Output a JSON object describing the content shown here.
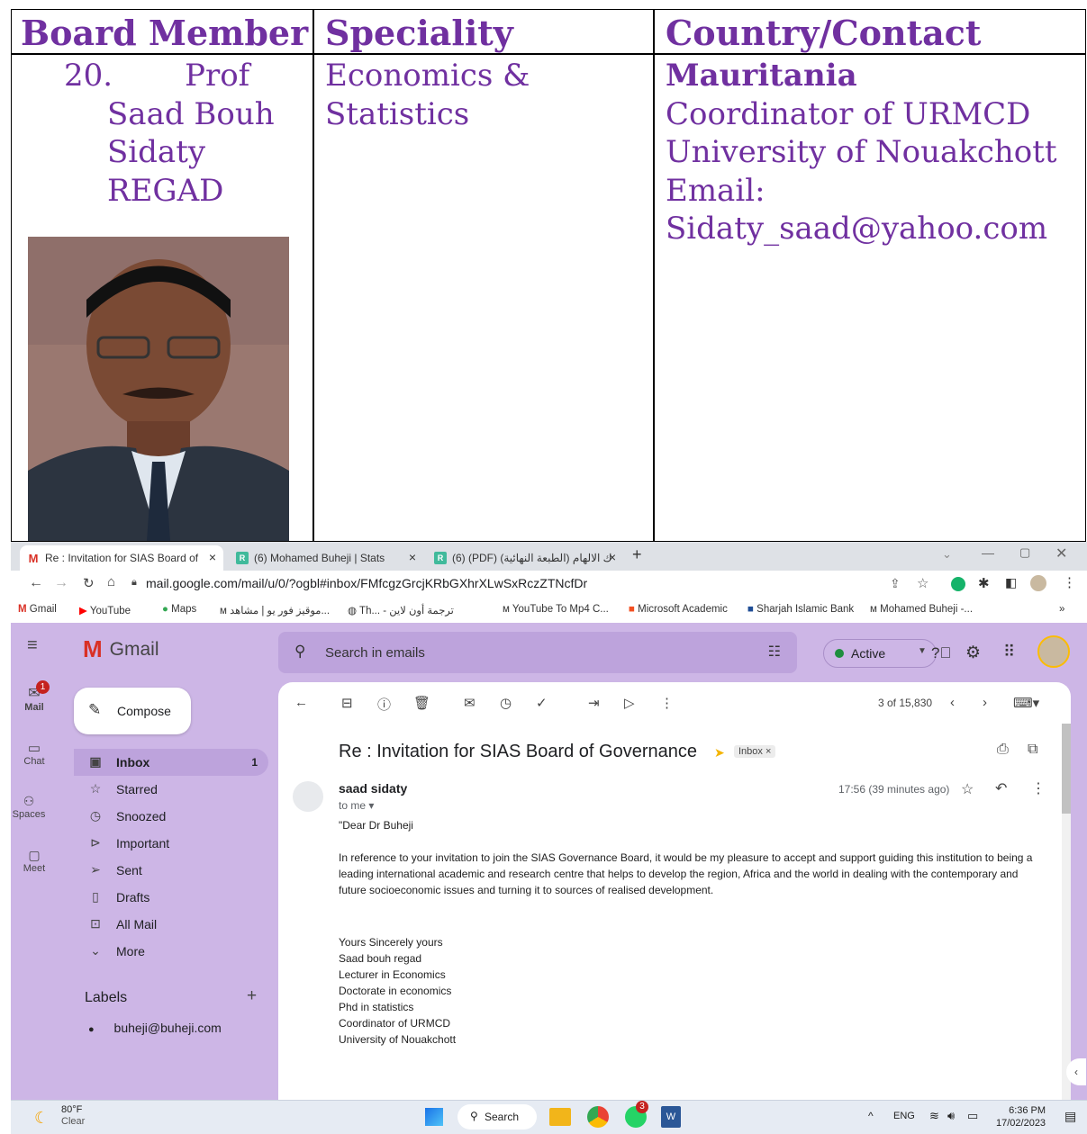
{
  "doc": {
    "headers": {
      "member": "Board Member",
      "speciality": "Speciality",
      "country": "Country/Contact"
    },
    "member": {
      "number": "20.",
      "title": "Prof",
      "name1": "Saad Bouh",
      "name2": "Sidaty",
      "name3": "REGAD"
    },
    "speciality": {
      "line1": "Economics &",
      "line2": "Statistics"
    },
    "contact": {
      "country": "Mauritania",
      "role": "Coordinator of URMCD",
      "university": "University of Nouakchott",
      "email_label": "Email:",
      "email": "Sidaty_saad@yahoo.com"
    }
  },
  "browser": {
    "tabs": [
      {
        "label": "Re : Invitation for SIAS Board of",
        "icon": "gmail-icon"
      },
      {
        "label": "(6) Mohamed Buheji | Stats",
        "icon": "researchgate-icon"
      },
      {
        "label": "(6) (PDF) (الطبعة النهائية) ك الالهام",
        "icon": "researchgate-icon"
      }
    ],
    "url": "mail.google.com/mail/u/0/?ogbl#inbox/FMfcgzGrcjKRbGXhrXLwSxRczZTNcfDr",
    "bookmarks": [
      "Gmail",
      "YouTube",
      "Maps",
      "موقيز فور يو | مشاهد...",
      "Th... - ترجمة أون لاين",
      "YouTube To Mp4 C...",
      "Microsoft Academic",
      "Sharjah Islamic Bank",
      "Mohamed Buheji -..."
    ],
    "more_bookmarks": "»"
  },
  "gmail": {
    "logo": "Gmail",
    "search_placeholder": "Search in emails",
    "status": "Active",
    "compose": "Compose",
    "rail": {
      "mail": "Mail",
      "mail_badge": "1",
      "chat": "Chat",
      "spaces": "Spaces",
      "meet": "Meet"
    },
    "nav": [
      {
        "label": "Inbox",
        "count": "1"
      },
      {
        "label": "Starred"
      },
      {
        "label": "Snoozed"
      },
      {
        "label": "Important"
      },
      {
        "label": "Sent"
      },
      {
        "label": "Drafts"
      },
      {
        "label": "All Mail"
      },
      {
        "label": "More"
      }
    ],
    "labels_title": "Labels",
    "label_items": [
      "buheji@buheji.com"
    ],
    "pager": "3 of 15,830",
    "subject": "Re : Invitation for SIAS Board of Governance",
    "inbox_chip": "Inbox ×",
    "sender": "saad sidaty",
    "to": "to me",
    "time": "17:56 (39 minutes ago)",
    "greeting": "\"Dear Dr Buheji",
    "para1": "In reference to your invitation to join the SIAS Governance Board, it would be my pleasure to accept and support guiding this institution to being a",
    "para2": "leading international academic and research centre that helps to develop the region, Africa and the world in dealing with the contemporary and",
    "para3": "future socioeconomic issues and turning it to sources of realised development.",
    "sig": [
      "Yours Sincerely yours",
      "Saad bouh regad",
      "Lecturer in Economics",
      "Doctorate in economics",
      "Phd in statistics",
      "Coordinator of URMCD",
      "University of Nouakchott"
    ]
  },
  "taskbar": {
    "temp": "80°F",
    "weather": "Clear",
    "search": "Search",
    "lang": "ENG",
    "time": "6:36 PM",
    "date": "17/02/2023",
    "whatsapp_badge": "3"
  }
}
